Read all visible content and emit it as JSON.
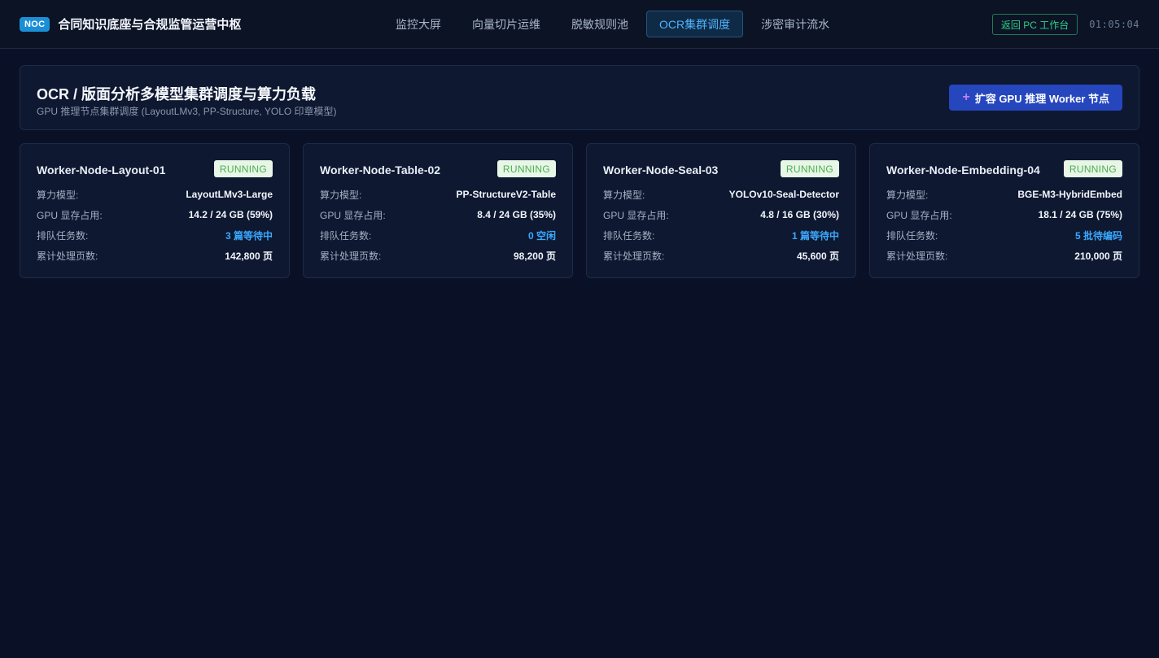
{
  "header": {
    "badge": "NOC",
    "title": "合同知识底座与合规监管运营中枢",
    "nav": [
      {
        "label": "监控大屏",
        "active": false
      },
      {
        "label": "向量切片运维",
        "active": false
      },
      {
        "label": "脱敏规则池",
        "active": false
      },
      {
        "label": "OCR集群调度",
        "active": true
      },
      {
        "label": "涉密审计流水",
        "active": false
      }
    ],
    "return_label": "返回 PC 工作台",
    "clock": "01:05:04"
  },
  "panel": {
    "title": "OCR / 版面分析多模型集群调度与算力负载",
    "subtitle": "GPU 推理节点集群调度 (LayoutLMv3, PP-Structure, YOLO 印章模型)",
    "scale_button": "扩容 GPU 推理 Worker 节点",
    "scale_icon": "plus-icon"
  },
  "labels": {
    "model": "算力模型:",
    "gpu": "GPU 显存占用:",
    "queue": "排队任务数:",
    "pages": "累计处理页数:"
  },
  "workers": [
    {
      "name": "Worker-Node-Layout-01",
      "status": "RUNNING",
      "model": "LayoutLMv3-Large",
      "gpu": "14.2 / 24 GB (59%)",
      "queue": "3 篇等待中",
      "pages": "142,800 页"
    },
    {
      "name": "Worker-Node-Table-02",
      "status": "RUNNING",
      "model": "PP-StructureV2-Table",
      "gpu": "8.4 / 24 GB (35%)",
      "queue": "0 空闲",
      "pages": "98,200 页"
    },
    {
      "name": "Worker-Node-Seal-03",
      "status": "RUNNING",
      "model": "YOLOv10-Seal-Detector",
      "gpu": "4.8 / 16 GB (30%)",
      "queue": "1 篇等待中",
      "pages": "45,600 页"
    },
    {
      "name": "Worker-Node-Embedding-04",
      "status": "RUNNING",
      "model": "BGE-M3-HybridEmbed",
      "gpu": "18.1 / 24 GB (75%)",
      "queue": "5 批待编码",
      "pages": "210,000 页"
    }
  ],
  "colors": {
    "accent": "#3aa8ff",
    "status_running_bg": "#e7f6e6",
    "status_running_fg": "#4caf50",
    "primary_button": "#2546bd",
    "return_green": "#2fcf8a"
  }
}
